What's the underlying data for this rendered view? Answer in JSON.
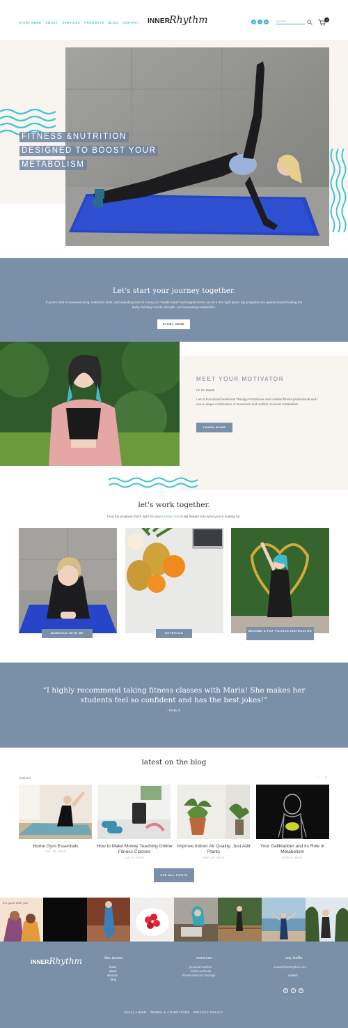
{
  "header": {
    "nav": [
      "START HERE",
      "ABOUT",
      "SERVICES",
      "PRODUCTS",
      "BLOG",
      "CONTACT"
    ],
    "logo_left": "INNER",
    "logo_right": "Rhythm",
    "search_placeholder": "SEARCH",
    "cart_count": "0"
  },
  "hero": {
    "title_lines": [
      "FITNESS &NUTRITION",
      "DESIGNED TO BOOST YOUR",
      "METABOLISM"
    ]
  },
  "journey": {
    "heading": "Let's start your journey together.",
    "body": "If you're tired of overexercising, restrictive diets, and spending tons of money on \"health foods\" and supplements, you're in the right place. My programs are geared toward fueling the body, building muscle strength, and increasing metabolism.",
    "button": "START HERE"
  },
  "motivator": {
    "heading": "MEET YOUR MOTIVATOR",
    "greeting": "Hi! I'm Maria!",
    "body": "I am a Functional Nutritional Therapy Practitioner and certified fitness professional and I use a unique combination of movement and nutrition to boost metabolism.",
    "button": "LEARN MORE"
  },
  "work": {
    "heading": "let's work together.",
    "intro_before": "Find the program that's right for you!",
    "intro_link": "Contact me",
    "intro_after": "to dig deeper into what you're looking for.",
    "cards": [
      "WORKOUT WITH ME",
      "NUTRITION",
      "BECOME A POP PILATES INSTRUCTOR"
    ]
  },
  "testimonial": {
    "quote": "“I highly recommend taking fitness classes with Maria! She makes her students feel so confident and has the best jokes!”",
    "author": "- Emily S."
  },
  "blog": {
    "heading": "latest on the blog",
    "featured_label": "Featured",
    "prev": "‹",
    "next": "›",
    "posts": [
      {
        "title": "Home Gym Essentials",
        "date": "JUL 15, 2020"
      },
      {
        "title": "How to Make Money Teaching Online Fitness Classes",
        "date": "JUL 6, 2020"
      },
      {
        "title": "Improve Indoor Air Quality: Just Add Plants",
        "date": "SEP 16, 2019"
      },
      {
        "title": "Your Gallbladder and its Role in Metabolism",
        "date": "APR 8, 2019"
      }
    ],
    "see_all": "SEE ALL POSTS"
  },
  "instagram": {
    "first_tile_text": "it's good with you"
  },
  "footer": {
    "logo_left": "INNER",
    "logo_right": "Rhythm",
    "menu_heading": "the menu",
    "menu_links": [
      "home",
      "about",
      "services",
      "blog"
    ],
    "services_heading": "services",
    "services_links": [
      "personal nutrition",
      "online workouts",
      "fitness instructor trainings"
    ],
    "hello_heading": "say hello",
    "email": "maria@innerrhythmi.com",
    "contact_link": "contact",
    "legal_links": [
      "DISCLAIMER",
      "TERMS & CONDITIONS",
      "PRIVACY POLICY"
    ]
  },
  "colors": {
    "accent": "#3fb8c9",
    "slate": "#7a8fa8",
    "cream": "#f8f5f1"
  }
}
